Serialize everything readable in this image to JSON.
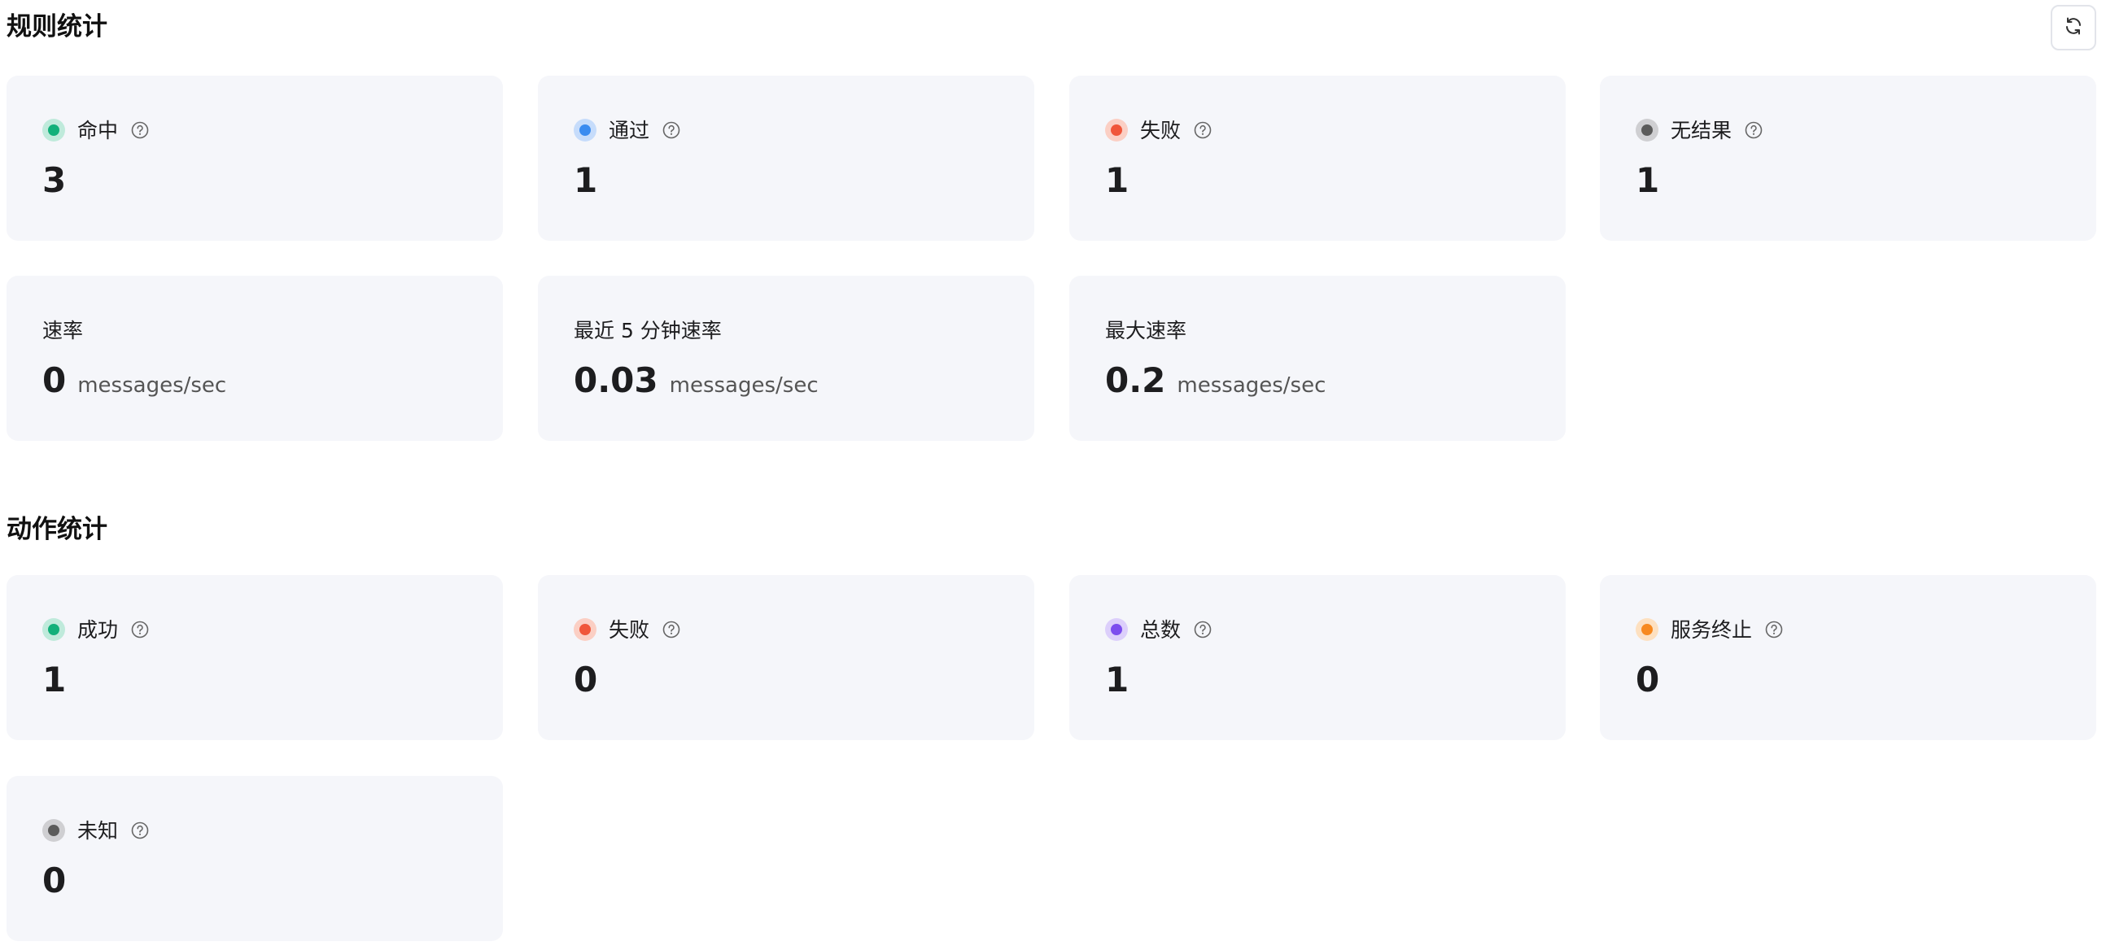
{
  "rule_stats": {
    "title": "规则统计",
    "cards": [
      {
        "label": "命中",
        "value": "3",
        "color": "#12b07a",
        "ring": "#bfeadb",
        "icon": "help-circle-icon"
      },
      {
        "label": "通过",
        "value": "1",
        "color": "#3b8cf0",
        "ring": "#c6dcfb",
        "icon": "help-circle-icon"
      },
      {
        "label": "失败",
        "value": "1",
        "color": "#f0563a",
        "ring": "#fbcfc4",
        "icon": "help-circle-icon"
      },
      {
        "label": "无结果",
        "value": "1",
        "color": "#5b5b5b",
        "ring": "#cfcfd2",
        "icon": "help-circle-icon"
      }
    ],
    "rates": [
      {
        "label": "速率",
        "value": "0",
        "unit": "messages/sec"
      },
      {
        "label": "最近 5 分钟速率",
        "value": "0.03",
        "unit": "messages/sec"
      },
      {
        "label": "最大速率",
        "value": "0.2",
        "unit": "messages/sec"
      }
    ]
  },
  "action_stats": {
    "title": "动作统计",
    "cards": [
      {
        "label": "成功",
        "value": "1",
        "color": "#12b07a",
        "ring": "#bfeadb",
        "icon": "help-circle-icon"
      },
      {
        "label": "失败",
        "value": "0",
        "color": "#f0563a",
        "ring": "#fbcfc4",
        "icon": "help-circle-icon"
      },
      {
        "label": "总数",
        "value": "1",
        "color": "#7c4dee",
        "ring": "#dccffb",
        "icon": "help-circle-icon"
      },
      {
        "label": "服务终止",
        "value": "0",
        "color": "#f7891f",
        "ring": "#fde0c0",
        "icon": "help-circle-icon"
      },
      {
        "label": "未知",
        "value": "0",
        "color": "#5b5b5b",
        "ring": "#cfcfd2",
        "icon": "help-circle-icon"
      }
    ]
  },
  "toolbar": {
    "refresh_icon": "refresh-icon"
  }
}
